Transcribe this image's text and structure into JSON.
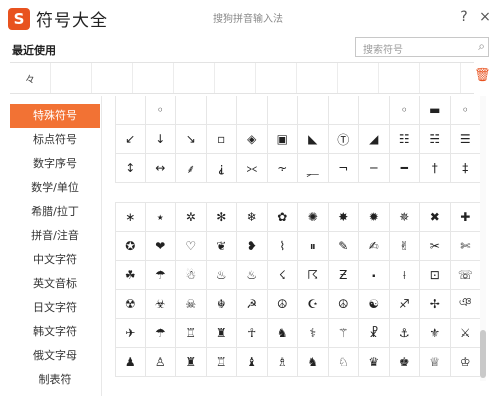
{
  "app": {
    "logo": "S",
    "title": "符号大全",
    "caption": "搜狗拼音输入法",
    "help_icon": "question-icon",
    "close_icon": "close-icon",
    "help_glyph": "?",
    "close_glyph": "×"
  },
  "recent": {
    "label": "最近使用",
    "items": [
      "々",
      "",
      "",
      "",
      "",
      "",
      "",
      "",
      "",
      "",
      ""
    ],
    "clear_glyph": "🗑"
  },
  "search": {
    "placeholder": "搜索符号",
    "value": "",
    "icon_glyph": "⌕"
  },
  "sidebar": {
    "items": [
      {
        "label": "特殊符号",
        "active": true
      },
      {
        "label": "标点符号"
      },
      {
        "label": "数字序号"
      },
      {
        "label": "数学/单位"
      },
      {
        "label": "希腊/拉丁"
      },
      {
        "label": "拼音/注音"
      },
      {
        "label": "中文字符"
      },
      {
        "label": "英文音标"
      },
      {
        "label": "日文字符"
      },
      {
        "label": "韩文字符"
      },
      {
        "label": "俄文字母"
      },
      {
        "label": "制表符"
      }
    ]
  },
  "symbols_top": [
    "",
    "◦",
    "",
    "",
    "",
    "",
    "",
    "",
    "",
    "",
    "",
    ""
  ],
  "symbols_top_rows": [
    [
      "",
      "◦",
      "",
      "",
      "",
      "",
      "",
      "",
      "",
      "◦",
      "▬",
      "◦"
    ],
    [
      "↙",
      "↓",
      "↘",
      "▫",
      "◈",
      "▣",
      "◣",
      "Ⓣ",
      "◢",
      "☷",
      "☵",
      "☰"
    ],
    [
      "↕",
      "↔",
      "⸙",
      "⸘",
      "⪥",
      "⸟",
      "⸐",
      "¬",
      "─",
      "━",
      "†",
      "‡"
    ]
  ],
  "symbols_bottom_rows": [
    [
      "∗",
      "⭑",
      "✲",
      "✻",
      "❄",
      "✿",
      "✺",
      "✸",
      "✹",
      "✵",
      "✖",
      "✚"
    ],
    [
      "✪",
      "❤",
      "♡",
      "❦",
      "❥",
      "⌇",
      "⏸",
      "✎",
      "✍",
      "✌",
      "✂",
      "✄"
    ],
    [
      "☘",
      "☂",
      "☃",
      "♨",
      "♨",
      "☇",
      "☈",
      "Ƶ",
      "⬝",
      "⟊",
      "⊡",
      "☏"
    ],
    [
      "☢",
      "☣",
      "☠",
      "☬",
      "☭",
      "☮",
      "☪",
      "☮",
      "☯",
      "♐",
      "✢",
      "ঞ"
    ],
    [
      "✈",
      "☂",
      "♖",
      "♜",
      "☥",
      "♞",
      "⚕",
      "⚚",
      "☧",
      "⚓",
      "⚜",
      "⚔"
    ],
    [
      "♟",
      "♙",
      "♜",
      "♖",
      "♝",
      "♗",
      "♞",
      "♘",
      "♛",
      "♚",
      "♕",
      "♔"
    ]
  ],
  "colors": {
    "accent": "#f27234",
    "brand": "#e8521f",
    "text": "#222222",
    "muted": "#8a8a8a"
  }
}
